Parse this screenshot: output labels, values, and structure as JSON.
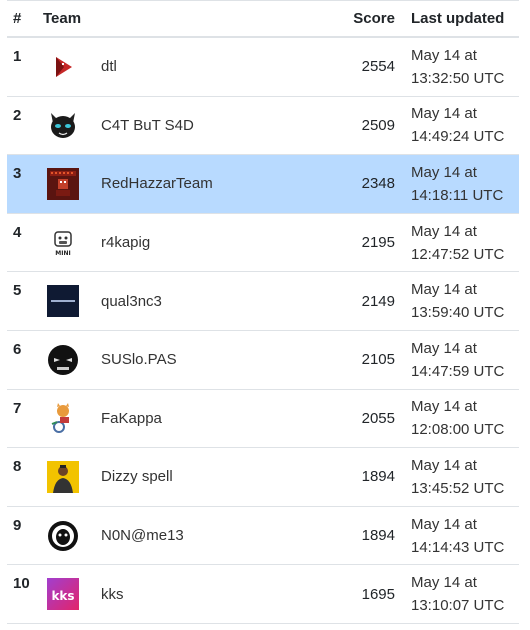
{
  "columns": {
    "rank": "#",
    "team": "Team",
    "score": "Score",
    "updated": "Last updated"
  },
  "highlight_color": "#b8daff",
  "rows": [
    {
      "rank": "1",
      "team": "dtl",
      "score": "2554",
      "date": "May 14 at",
      "time": "13:32:50 UTC",
      "logo": "red-triangle-logo"
    },
    {
      "rank": "2",
      "team": "C4T BuT S4D",
      "score": "2509",
      "date": "May 14 at",
      "time": "14:49:24 UTC",
      "logo": "cat-face-logo"
    },
    {
      "rank": "3",
      "team": "RedHazzarTeam",
      "score": "2348",
      "date": "May 14 at",
      "time": "14:18:11 UTC",
      "logo": "red-pixel-logo",
      "highlighted": true
    },
    {
      "rank": "4",
      "team": "r4kapig",
      "score": "2195",
      "date": "May 14 at",
      "time": "12:47:52 UTC",
      "logo": "pig-mini-logo"
    },
    {
      "rank": "5",
      "team": "qual3nc3",
      "score": "2149",
      "date": "May 14 at",
      "time": "13:59:40 UTC",
      "logo": "navy-text-logo"
    },
    {
      "rank": "6",
      "team": "SUSlo.PAS",
      "score": "2105",
      "date": "May 14 at",
      "time": "14:47:59 UTC",
      "logo": "dark-eyes-logo"
    },
    {
      "rank": "7",
      "team": "FaKappa",
      "score": "2055",
      "date": "May 14 at",
      "time": "12:08:00 UTC",
      "logo": "wheelchair-cat-logo"
    },
    {
      "rank": "8",
      "team": "Dizzy spell",
      "score": "1894",
      "date": "May 14 at",
      "time": "13:45:52 UTC",
      "logo": "person-yellow-logo"
    },
    {
      "rank": "9",
      "team": "N0N@me13",
      "score": "1894",
      "date": "May 14 at",
      "time": "14:14:43 UTC",
      "logo": "mask-circle-logo"
    },
    {
      "rank": "10",
      "team": "kks",
      "score": "1695",
      "date": "May 14 at",
      "time": "13:10:07 UTC",
      "logo": "kks-gradient-logo"
    }
  ]
}
